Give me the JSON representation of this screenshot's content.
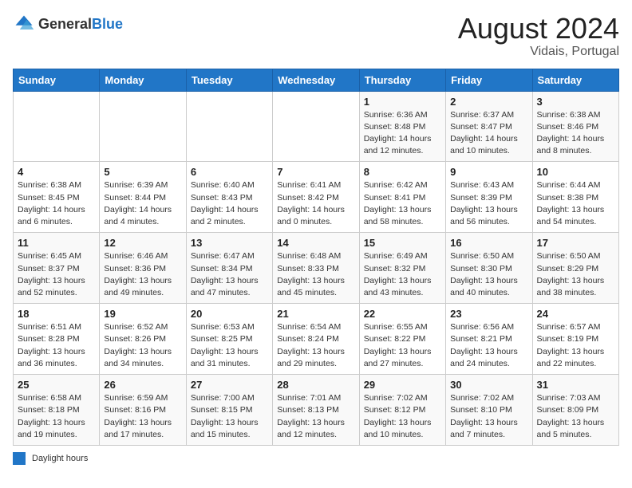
{
  "header": {
    "logo_general": "General",
    "logo_blue": "Blue",
    "title": "August 2024",
    "subtitle": "Vidais, Portugal"
  },
  "days_of_week": [
    "Sunday",
    "Monday",
    "Tuesday",
    "Wednesday",
    "Thursday",
    "Friday",
    "Saturday"
  ],
  "legend": {
    "label": "Daylight hours"
  },
  "weeks": [
    {
      "days": [
        {
          "num": "",
          "info": ""
        },
        {
          "num": "",
          "info": ""
        },
        {
          "num": "",
          "info": ""
        },
        {
          "num": "",
          "info": ""
        },
        {
          "num": "1",
          "info": "Sunrise: 6:36 AM\nSunset: 8:48 PM\nDaylight: 14 hours\nand 12 minutes."
        },
        {
          "num": "2",
          "info": "Sunrise: 6:37 AM\nSunset: 8:47 PM\nDaylight: 14 hours\nand 10 minutes."
        },
        {
          "num": "3",
          "info": "Sunrise: 6:38 AM\nSunset: 8:46 PM\nDaylight: 14 hours\nand 8 minutes."
        }
      ]
    },
    {
      "days": [
        {
          "num": "4",
          "info": "Sunrise: 6:38 AM\nSunset: 8:45 PM\nDaylight: 14 hours\nand 6 minutes."
        },
        {
          "num": "5",
          "info": "Sunrise: 6:39 AM\nSunset: 8:44 PM\nDaylight: 14 hours\nand 4 minutes."
        },
        {
          "num": "6",
          "info": "Sunrise: 6:40 AM\nSunset: 8:43 PM\nDaylight: 14 hours\nand 2 minutes."
        },
        {
          "num": "7",
          "info": "Sunrise: 6:41 AM\nSunset: 8:42 PM\nDaylight: 14 hours\nand 0 minutes."
        },
        {
          "num": "8",
          "info": "Sunrise: 6:42 AM\nSunset: 8:41 PM\nDaylight: 13 hours\nand 58 minutes."
        },
        {
          "num": "9",
          "info": "Sunrise: 6:43 AM\nSunset: 8:39 PM\nDaylight: 13 hours\nand 56 minutes."
        },
        {
          "num": "10",
          "info": "Sunrise: 6:44 AM\nSunset: 8:38 PM\nDaylight: 13 hours\nand 54 minutes."
        }
      ]
    },
    {
      "days": [
        {
          "num": "11",
          "info": "Sunrise: 6:45 AM\nSunset: 8:37 PM\nDaylight: 13 hours\nand 52 minutes."
        },
        {
          "num": "12",
          "info": "Sunrise: 6:46 AM\nSunset: 8:36 PM\nDaylight: 13 hours\nand 49 minutes."
        },
        {
          "num": "13",
          "info": "Sunrise: 6:47 AM\nSunset: 8:34 PM\nDaylight: 13 hours\nand 47 minutes."
        },
        {
          "num": "14",
          "info": "Sunrise: 6:48 AM\nSunset: 8:33 PM\nDaylight: 13 hours\nand 45 minutes."
        },
        {
          "num": "15",
          "info": "Sunrise: 6:49 AM\nSunset: 8:32 PM\nDaylight: 13 hours\nand 43 minutes."
        },
        {
          "num": "16",
          "info": "Sunrise: 6:50 AM\nSunset: 8:30 PM\nDaylight: 13 hours\nand 40 minutes."
        },
        {
          "num": "17",
          "info": "Sunrise: 6:50 AM\nSunset: 8:29 PM\nDaylight: 13 hours\nand 38 minutes."
        }
      ]
    },
    {
      "days": [
        {
          "num": "18",
          "info": "Sunrise: 6:51 AM\nSunset: 8:28 PM\nDaylight: 13 hours\nand 36 minutes."
        },
        {
          "num": "19",
          "info": "Sunrise: 6:52 AM\nSunset: 8:26 PM\nDaylight: 13 hours\nand 34 minutes."
        },
        {
          "num": "20",
          "info": "Sunrise: 6:53 AM\nSunset: 8:25 PM\nDaylight: 13 hours\nand 31 minutes."
        },
        {
          "num": "21",
          "info": "Sunrise: 6:54 AM\nSunset: 8:24 PM\nDaylight: 13 hours\nand 29 minutes."
        },
        {
          "num": "22",
          "info": "Sunrise: 6:55 AM\nSunset: 8:22 PM\nDaylight: 13 hours\nand 27 minutes."
        },
        {
          "num": "23",
          "info": "Sunrise: 6:56 AM\nSunset: 8:21 PM\nDaylight: 13 hours\nand 24 minutes."
        },
        {
          "num": "24",
          "info": "Sunrise: 6:57 AM\nSunset: 8:19 PM\nDaylight: 13 hours\nand 22 minutes."
        }
      ]
    },
    {
      "days": [
        {
          "num": "25",
          "info": "Sunrise: 6:58 AM\nSunset: 8:18 PM\nDaylight: 13 hours\nand 19 minutes."
        },
        {
          "num": "26",
          "info": "Sunrise: 6:59 AM\nSunset: 8:16 PM\nDaylight: 13 hours\nand 17 minutes."
        },
        {
          "num": "27",
          "info": "Sunrise: 7:00 AM\nSunset: 8:15 PM\nDaylight: 13 hours\nand 15 minutes."
        },
        {
          "num": "28",
          "info": "Sunrise: 7:01 AM\nSunset: 8:13 PM\nDaylight: 13 hours\nand 12 minutes."
        },
        {
          "num": "29",
          "info": "Sunrise: 7:02 AM\nSunset: 8:12 PM\nDaylight: 13 hours\nand 10 minutes."
        },
        {
          "num": "30",
          "info": "Sunrise: 7:02 AM\nSunset: 8:10 PM\nDaylight: 13 hours\nand 7 minutes."
        },
        {
          "num": "31",
          "info": "Sunrise: 7:03 AM\nSunset: 8:09 PM\nDaylight: 13 hours\nand 5 minutes."
        }
      ]
    }
  ]
}
